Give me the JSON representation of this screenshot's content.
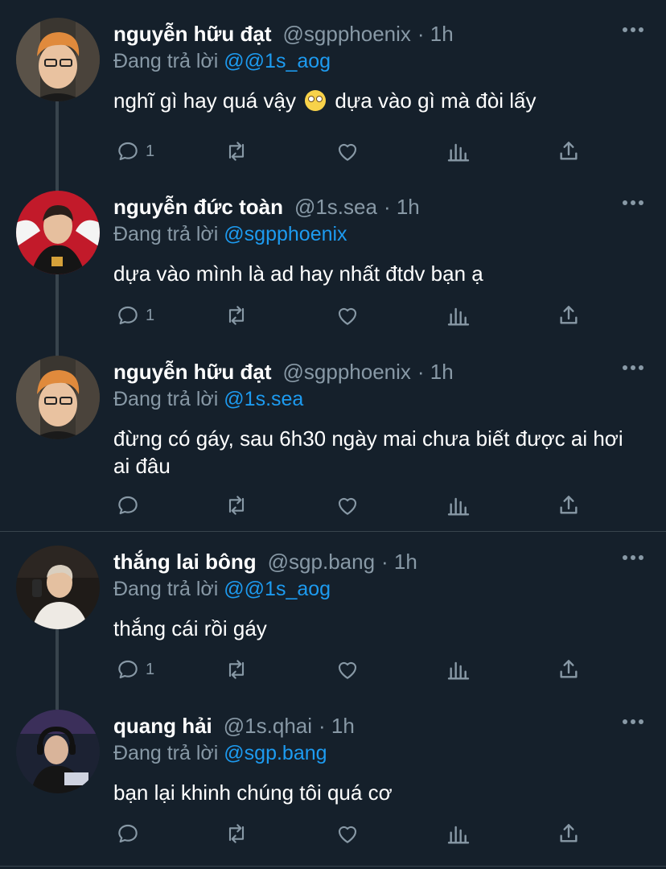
{
  "colors": {
    "background": "#15202b",
    "text": "#ffffff",
    "muted": "#8899a6",
    "link": "#1d9bf0",
    "border": "#38444d"
  },
  "replying_prefix": "Đang trả lời",
  "tweets": [
    {
      "name": "nguyễn hữu đạt",
      "handle": "@sgpphoenix",
      "time": "· 1h",
      "reply_to": "@@1s_aog",
      "text_before": "nghĩ gì hay quá vậy",
      "emoji": "face-with-rolling-eyes",
      "text_after": "dựa vào gì mà đòi lấy",
      "reply_count": "1"
    },
    {
      "name": "nguyễn đức toàn",
      "handle": "@1s.sea",
      "time": "· 1h",
      "reply_to": "@sgpphoenix",
      "text": "dựa vào mình là ad hay nhất đtdv bạn ạ",
      "reply_count": "1"
    },
    {
      "name": "nguyễn hữu đạt",
      "handle": "@sgpphoenix",
      "time": "· 1h",
      "reply_to": "@1s.sea",
      "text": "đừng có gáy, sau 6h30 ngày mai chưa biết được ai hơi ai đâu",
      "reply_count": ""
    },
    {
      "name": "thắng lai bông",
      "handle": "@sgp.bang",
      "time": "· 1h",
      "reply_to": "@@1s_aog",
      "text": "thắng cái rồi gáy",
      "reply_count": "1"
    },
    {
      "name": "quang hải",
      "handle": "@1s.qhai",
      "time": "· 1h",
      "reply_to": "@sgp.bang",
      "text": "bạn lại khinh chúng tôi quá cơ",
      "reply_count": ""
    }
  ],
  "icons": [
    "reply-icon",
    "retweet-icon",
    "like-icon",
    "analytics-icon",
    "share-icon",
    "more-icon"
  ]
}
